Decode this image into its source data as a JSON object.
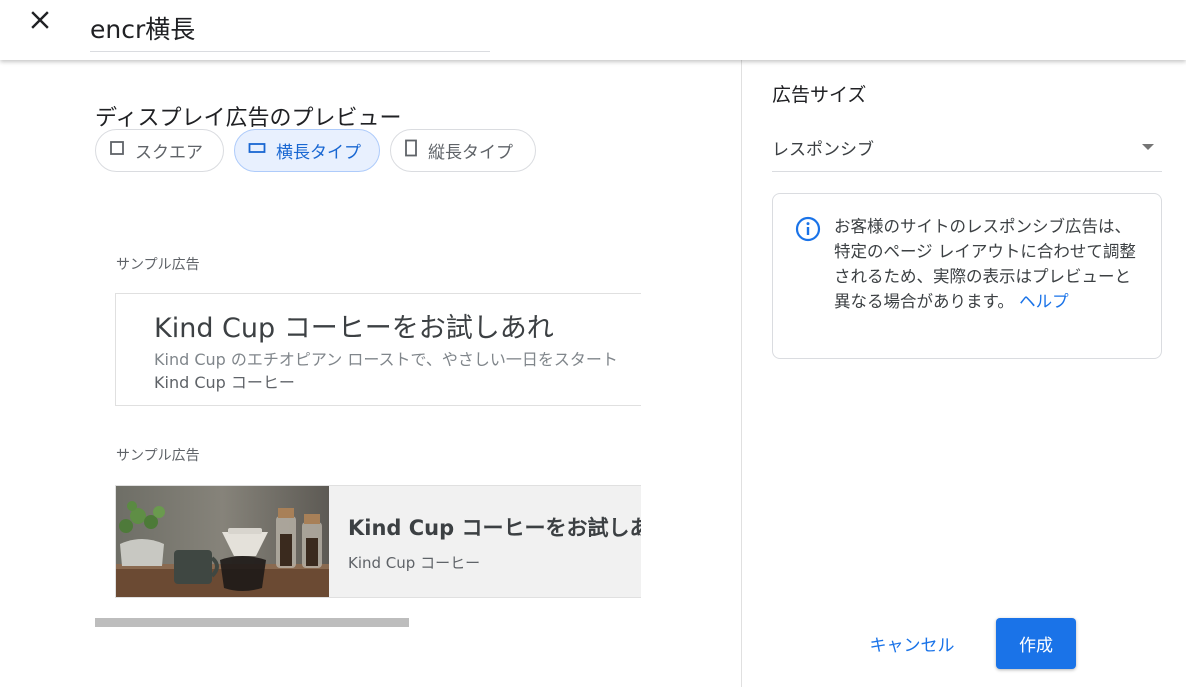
{
  "header": {
    "close_icon": "close-icon",
    "name_value": "encr横長"
  },
  "preview": {
    "title": "ディスプレイ広告のプレビュー",
    "chips": [
      {
        "label": "スクエア",
        "icon": "square-icon",
        "selected": false
      },
      {
        "label": "横長タイプ",
        "icon": "landscape-icon",
        "selected": true
      },
      {
        "label": "縦長タイプ",
        "icon": "portrait-icon",
        "selected": false
      }
    ],
    "ads": [
      {
        "label": "サンプル広告",
        "headline": "Kind Cup コーヒーをお試しあれ",
        "description": "Kind Cup のエチオピアン ローストで、やさしい一日をスタート",
        "business": "Kind Cup コーヒー"
      },
      {
        "label": "サンプル広告",
        "headline": "Kind Cup コーヒーをお試しあれ",
        "business": "Kind Cup コーヒー",
        "image": "coffee-image"
      }
    ]
  },
  "settings": {
    "size_title": "広告サイズ",
    "size_value": "レスポンシブ",
    "info_icon": "info-icon",
    "info_text": "お客様のサイトのレスポンシブ広告は、特定のページ レイアウトに合わせて調整されるため、実際の表示はプレビューと異なる場合があります。",
    "help_link": "ヘルプ"
  },
  "actions": {
    "cancel": "キャンセル",
    "create": "作成"
  },
  "colors": {
    "accent": "#1a73e8",
    "chip_selected_bg": "#e8f0fe"
  }
}
